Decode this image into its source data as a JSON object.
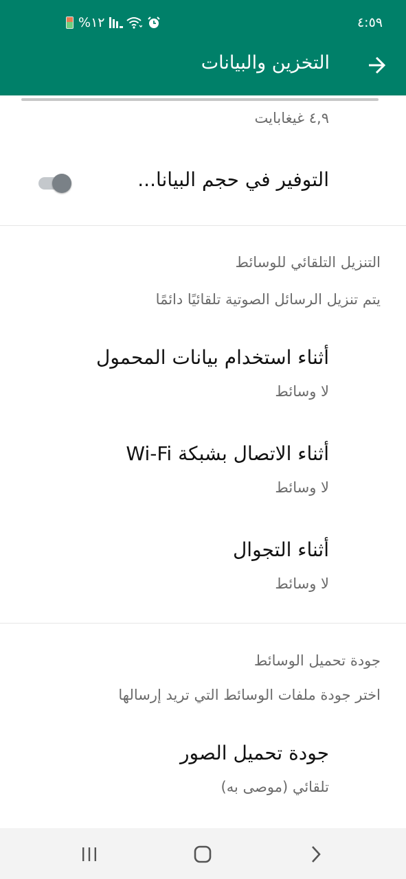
{
  "status_bar": {
    "time": "٤:٥٩",
    "battery_text": "%١٢"
  },
  "toolbar": {
    "title": "التخزين والبيانات"
  },
  "network": {
    "size": "٤,٩ غيغابايت",
    "data_saver_label": "التوفير في حجم البيانا...",
    "data_saver_on": false
  },
  "auto_download": {
    "title": "التنزيل التلقائي للوسائط",
    "description": "يتم تنزيل الرسائل الصوتية تلقائيًا دائمًا",
    "items": [
      {
        "title": "أثناء استخدام بيانات المحمول",
        "value": "لا وسائط"
      },
      {
        "title": "أثناء الاتصال بشبكة Wi-Fi",
        "value": "لا وسائط"
      },
      {
        "title": "أثناء التجوال",
        "value": "لا وسائط"
      }
    ]
  },
  "upload_quality": {
    "title": "جودة تحميل الوسائط",
    "description": "اختر جودة ملفات الوسائط التي تريد إرسالها",
    "items": [
      {
        "title": "جودة تحميل الصور",
        "value": "تلقائي (موصى به)"
      }
    ]
  },
  "colors": {
    "header": "#008069",
    "toggle_knob_off": "#7a8187"
  }
}
